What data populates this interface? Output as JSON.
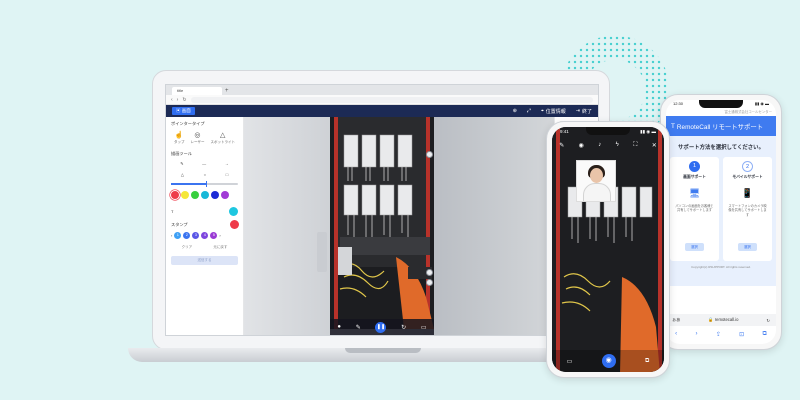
{
  "colors": {
    "background": "#dff4f4",
    "header": "#1c2a55",
    "accent": "#2f6df0",
    "cyan": "#1ec7c7"
  },
  "laptop": {
    "browser_tab_label": "title",
    "header": {
      "logo": "▣ 画面",
      "btn_capture": "⊕",
      "btn_fullscreen": "⤢",
      "btn_location_label": "位置情報",
      "btn_exit_label": "終了"
    },
    "tools": {
      "pointer_title": "ポインタータイプ",
      "pointer_items": [
        "タップ",
        "レーザー",
        "スポットライト"
      ],
      "draw_title": "描画ツール",
      "swatch_colors": [
        "#ee3b4a",
        "#f5e73a",
        "#37cf3e",
        "#18b8d8",
        "#1c2ad6",
        "#a13bd6"
      ],
      "stamp_title": "スタンプ",
      "stamp_labels": [
        "1",
        "2",
        "3",
        "4",
        "5"
      ],
      "stamp_colors": [
        "#3ea0f5",
        "#3b74f0",
        "#5a57e6",
        "#7e46de",
        "#9a3bd4"
      ],
      "btn_left": "クリア",
      "btn_right": "元に戻す",
      "submit": "送信する"
    },
    "right_panel": {
      "section1": "ポインタータイプ",
      "section2": "描画ツール",
      "section3": "スタンプ",
      "section4": "ズーム"
    }
  },
  "phone1": {
    "time": "9:41",
    "status_right": "▮▮ ◉ ▬"
  },
  "phone2": {
    "time": "12:30",
    "status_right": "▮▮ ◉ ▬",
    "top_caption": "富士通株式会社コールセンター",
    "brand": "RemoteCall リモートサポート",
    "brand_icon": "T",
    "title": "サポート方法を選択してください。",
    "cards": [
      {
        "num": "1",
        "title": "画面サポート",
        "desc": "パソコンの画面をお客様と共有してサポートします",
        "button": "選択"
      },
      {
        "num": "2",
        "title": "モバイルサポート",
        "desc": "スマートフォンのカメラ映像を共有してサポートします",
        "button": "選択"
      }
    ],
    "footer": "Copyright(c) RSUPPORT. All rights reserved.",
    "url_left": "ぁあ",
    "url": "🔒 remotecall.io",
    "url_right": "↻",
    "nav": [
      "‹",
      "›",
      "⇪",
      "⊡",
      "⧉"
    ]
  }
}
